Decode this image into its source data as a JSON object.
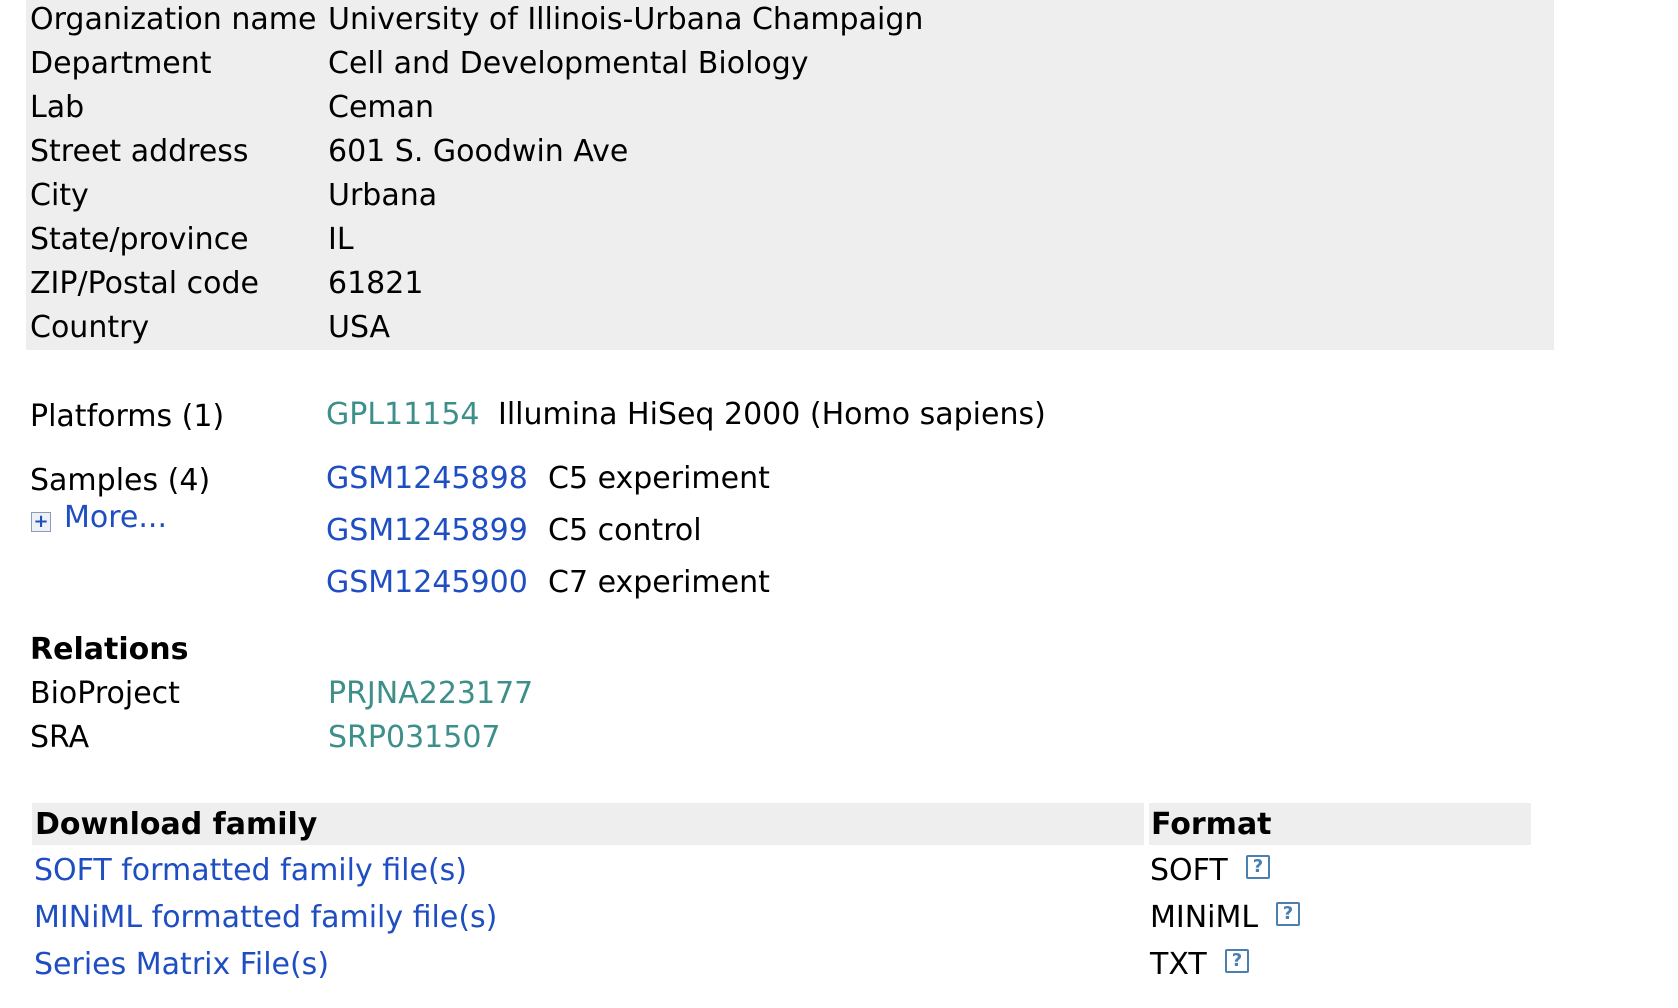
{
  "contact": {
    "rows": [
      {
        "label": "Organization name",
        "value": "University of Illinois-Urbana Champaign"
      },
      {
        "label": "Department",
        "value": "Cell and Developmental Biology"
      },
      {
        "label": "Lab",
        "value": "Ceman"
      },
      {
        "label": "Street address",
        "value": "601 S. Goodwin Ave"
      },
      {
        "label": "City",
        "value": "Urbana"
      },
      {
        "label": "State/province",
        "value": "IL"
      },
      {
        "label": "ZIP/Postal code",
        "value": "61821"
      },
      {
        "label": "Country",
        "value": "USA"
      }
    ]
  },
  "platforms": {
    "label": "Platforms (1)",
    "items": [
      {
        "id": "GPL11154",
        "desc": "Illumina HiSeq 2000 (Homo sapiens)"
      }
    ]
  },
  "samples": {
    "label": "Samples (4)",
    "more_icon": "+",
    "more_label": "More...",
    "items": [
      {
        "id": "GSM1245898",
        "desc": "C5 experiment"
      },
      {
        "id": "GSM1245899",
        "desc": "C5 control"
      },
      {
        "id": "GSM1245900",
        "desc": "C7 experiment"
      }
    ]
  },
  "relations": {
    "heading": "Relations",
    "rows": [
      {
        "label": "BioProject",
        "value": "PRJNA223177"
      },
      {
        "label": "SRA",
        "value": "SRP031507"
      }
    ]
  },
  "downloads": {
    "header_family": "Download family",
    "header_format": "Format",
    "help_icon": "?",
    "rows": [
      {
        "link": "SOFT formatted family file(s)",
        "format": "SOFT"
      },
      {
        "link": "MINiML formatted family file(s)",
        "format": "MINiML"
      },
      {
        "link": "Series Matrix File(s)",
        "format": "TXT"
      }
    ]
  },
  "colors": {
    "link_teal": "#3d8f8a",
    "link_blue": "#1f4ec2",
    "panel_gray": "#eeeeee"
  }
}
